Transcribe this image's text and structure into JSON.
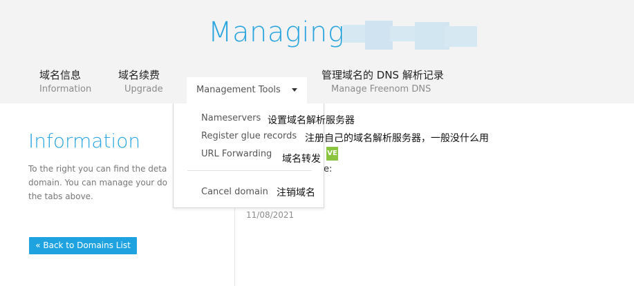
{
  "header": {
    "title": "Managing"
  },
  "tabs": [
    {
      "cn": "域名信息",
      "en": "Information"
    },
    {
      "cn": "域名续费",
      "en": "Upgrade"
    },
    {
      "label": "Management Tools"
    },
    {
      "cn": "管理域名的 DNS 解析记录",
      "en": "Manage Freenom DNS"
    }
  ],
  "dropdown": {
    "items": [
      {
        "label": "Nameservers",
        "note": "设置域名解析服务器"
      },
      {
        "label": "Register glue records",
        "note": "注册自己的域名解析服务器，一般没什么用"
      },
      {
        "label": "URL Forwarding",
        "note": "域名转发"
      },
      {
        "label": "Cancel domain",
        "note": "注销域名"
      }
    ]
  },
  "sidebar": {
    "title": "Information",
    "description_lines": [
      "To the right you can find the deta",
      "domain. You can manage your do",
      "the tabs above."
    ],
    "back_button": "« Back to Domains List"
  },
  "details": {
    "partial_label": "e:",
    "date": "11/08/2021",
    "badge": "VE"
  },
  "colors": {
    "accent": "#2aa5df",
    "button": "#1fa3e0",
    "badge": "#8bc53f",
    "header_bg": "#f3f3f3"
  }
}
